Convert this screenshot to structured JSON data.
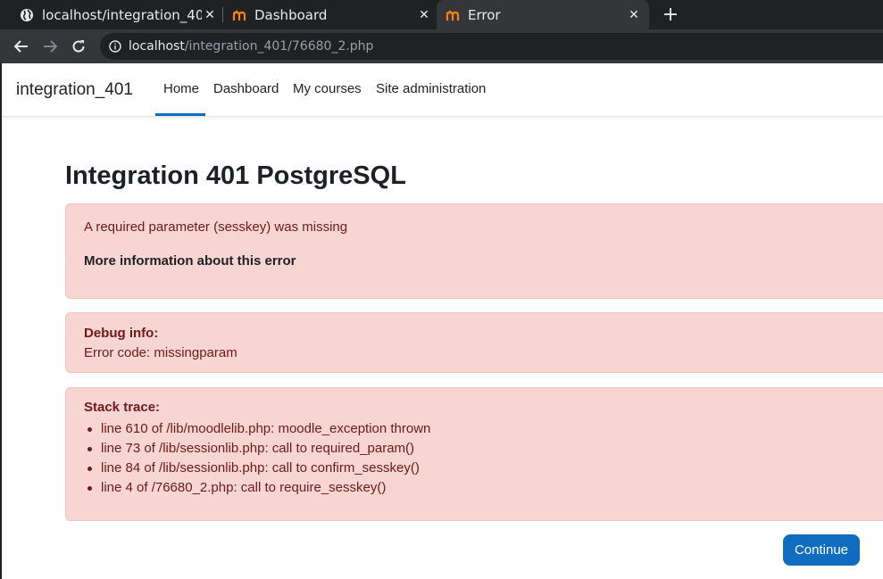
{
  "browser": {
    "tabs": [
      {
        "title": "localhost/integration_40",
        "icon": "globe-icon",
        "active": false
      },
      {
        "title": "Dashboard",
        "icon": "moodle-icon",
        "active": false
      },
      {
        "title": "Error",
        "icon": "moodle-icon",
        "active": true
      }
    ],
    "new_tab": "+",
    "url_host": "localhost",
    "url_path": "/integration_401/76680_2.php"
  },
  "navbar": {
    "site_name": "integration_401",
    "links": [
      "Home",
      "Dashboard",
      "My courses",
      "Site administration"
    ],
    "active_link": "Home"
  },
  "page": {
    "heading": "Integration 401 PostgreSQL",
    "error_message": "A required parameter (sesskey) was missing",
    "more_info": "More information about this error",
    "debug_title": "Debug info:",
    "debug_code": "Error code: missingparam",
    "stack_title": "Stack trace:",
    "stack_trace": [
      "line 610 of /lib/moodlelib.php: moodle_exception thrown",
      "line 73 of /lib/sessionlib.php: call to required_param()",
      "line 84 of /lib/sessionlib.php: call to confirm_sesskey()",
      "line 4 of /76680_2.php: call to require_sesskey()"
    ],
    "continue_label": "Continue"
  },
  "colors": {
    "primary": "#0f6cbf",
    "alert_bg": "#f6d5d2",
    "alert_text": "#6e1a1a",
    "chrome_dark": "#202124",
    "chrome_toolbar": "#35363a"
  }
}
